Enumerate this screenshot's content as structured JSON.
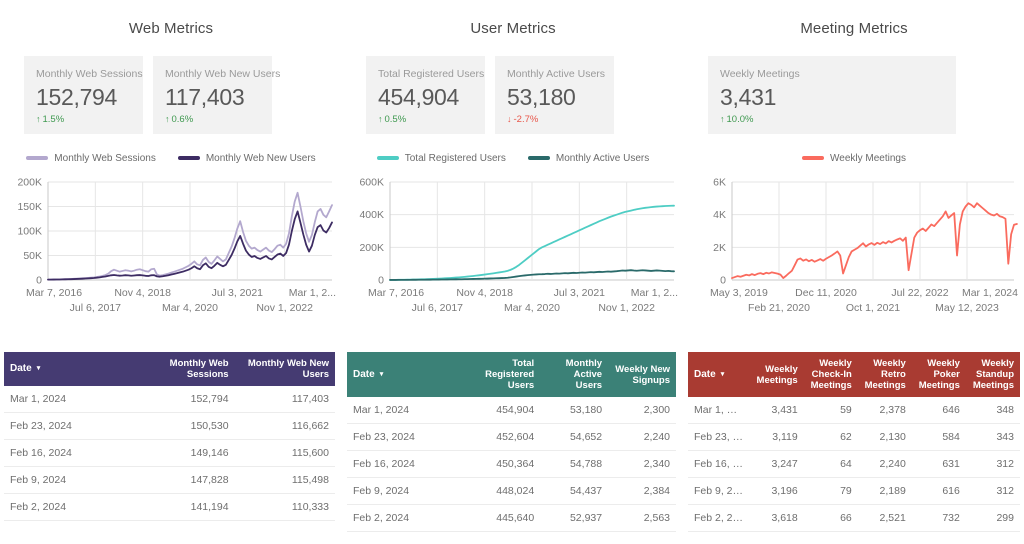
{
  "panels": [
    {
      "title": "Web Metrics",
      "tiles": [
        {
          "label": "Monthly Web Sessions",
          "value": "152,794",
          "delta": "1.5%",
          "direction": "up",
          "arrow": "↑"
        },
        {
          "label": "Monthly Web New Users",
          "value": "117,403",
          "delta": "0.6%",
          "direction": "up",
          "arrow": "↑"
        }
      ],
      "legend": [
        {
          "label": "Monthly Web Sessions",
          "color": "#b3a8ce"
        },
        {
          "label": "Monthly Web New Users",
          "color": "#3d2c63"
        }
      ]
    },
    {
      "title": "User Metrics",
      "tiles": [
        {
          "label": "Total Registered Users",
          "value": "454,904",
          "delta": "0.5%",
          "direction": "up",
          "arrow": "↑"
        },
        {
          "label": "Monthly Active Users",
          "value": "53,180",
          "delta": "-2.7%",
          "direction": "down",
          "arrow": "↓"
        }
      ],
      "legend": [
        {
          "label": "Total Registered Users",
          "color": "#4ecdc4"
        },
        {
          "label": "Monthly Active Users",
          "color": "#2a6a6a"
        }
      ]
    },
    {
      "title": "Meeting Metrics",
      "tiles": [
        {
          "label": "Weekly Meetings",
          "value": "3,431",
          "delta": "10.0%",
          "direction": "up",
          "arrow": "↑"
        }
      ],
      "legend": [
        {
          "label": "Weekly Meetings",
          "color": "#fa6b5e"
        }
      ]
    }
  ],
  "chart_data": [
    {
      "type": "line",
      "title": "Web Metrics",
      "xlabel": "",
      "ylabel": "",
      "ylim": [
        0,
        200000
      ],
      "yticks": [
        0,
        50000,
        100000,
        150000,
        200000
      ],
      "yticklabels": [
        "0",
        "50K",
        "100K",
        "150K",
        "200K"
      ],
      "grid": true,
      "legend_position": "top",
      "xticklabels": [
        "Mar 7, 2016",
        "Jul 6, 2017",
        "Nov 4, 2018",
        "Mar 4, 2020",
        "Jul 3, 2021",
        "Nov 1, 2022",
        "Mar 1, 2..."
      ],
      "x": [
        0,
        1,
        2,
        3,
        4,
        5,
        6,
        7,
        8,
        9,
        10,
        11,
        12,
        13,
        14,
        15,
        16,
        17,
        18,
        19,
        20,
        21,
        22,
        23,
        24,
        25,
        26,
        27,
        28,
        29,
        30,
        31,
        32,
        33,
        34,
        35,
        36,
        37,
        38,
        39,
        40,
        41,
        42,
        43,
        44,
        45,
        46,
        47,
        48,
        49,
        50,
        51,
        52,
        53,
        54,
        55,
        56,
        57,
        58,
        59,
        60,
        61,
        62,
        63,
        64,
        65,
        66,
        67,
        68,
        69,
        70,
        71,
        72,
        73,
        74,
        75,
        76,
        77,
        78,
        79,
        80,
        81,
        82,
        83,
        84,
        85,
        86,
        87,
        88,
        89,
        90,
        91,
        92,
        93,
        94,
        95,
        96,
        97,
        98,
        99
      ],
      "series": [
        {
          "name": "Monthly Web Sessions",
          "color": "#b3a8ce",
          "values": [
            900,
            1000,
            1100,
            1200,
            1300,
            1500,
            1700,
            1900,
            2100,
            2400,
            2700,
            3000,
            3400,
            3800,
            4200,
            4700,
            5200,
            6000,
            7000,
            8500,
            10000,
            13000,
            18000,
            21000,
            19000,
            17000,
            18500,
            20000,
            19000,
            17500,
            19000,
            21000,
            22000,
            20000,
            18000,
            17000,
            22000,
            23000,
            11000,
            9000,
            10000,
            11500,
            13000,
            15000,
            17000,
            19000,
            21000,
            23000,
            26000,
            29000,
            33000,
            38000,
            32000,
            30000,
            41000,
            46000,
            37000,
            33000,
            40000,
            48000,
            43000,
            38000,
            42000,
            55000,
            68000,
            85000,
            105000,
            120000,
            98000,
            80000,
            70000,
            64000,
            66000,
            61000,
            58000,
            62000,
            66000,
            60000,
            57000,
            63000,
            70000,
            72000,
            66000,
            74000,
            95000,
            130000,
            160000,
            178000,
            150000,
            120000,
            95000,
            78000,
            92000,
            118000,
            140000,
            145000,
            133000,
            128000,
            140000,
            152794
          ]
        },
        {
          "name": "Monthly Web New Users",
          "color": "#3d2c63",
          "values": [
            700,
            800,
            880,
            960,
            1040,
            1200,
            1360,
            1520,
            1680,
            1900,
            2150,
            2400,
            2700,
            3000,
            3300,
            3700,
            4100,
            4700,
            5400,
            6400,
            7200,
            8400,
            9600,
            10200,
            9400,
            8800,
            9200,
            9800,
            9400,
            8700,
            9200,
            9800,
            10100,
            9400,
            8600,
            8200,
            9600,
            9900,
            7400,
            6800,
            7600,
            8600,
            9800,
            11200,
            12600,
            14000,
            15600,
            17000,
            19000,
            21000,
            24000,
            28000,
            24000,
            22000,
            30000,
            34000,
            27000,
            24000,
            29000,
            35000,
            31000,
            28000,
            31000,
            41000,
            51000,
            64000,
            79000,
            90000,
            74000,
            60000,
            52000,
            47000,
            49000,
            45000,
            43000,
            46000,
            49000,
            44000,
            42000,
            47000,
            52000,
            54000,
            49000,
            55000,
            72000,
            100000,
            124000,
            140000,
            117000,
            93000,
            72000,
            58000,
            70000,
            92000,
            108000,
            112000,
            101000,
            97000,
            106000,
            117403
          ]
        }
      ]
    },
    {
      "type": "line",
      "title": "User Metrics",
      "xlabel": "",
      "ylabel": "",
      "ylim": [
        0,
        600000
      ],
      "yticks": [
        0,
        200000,
        400000,
        600000
      ],
      "yticklabels": [
        "0",
        "200K",
        "400K",
        "600K"
      ],
      "grid": true,
      "legend_position": "top",
      "xticklabels": [
        "Mar 7, 2016",
        "Jul 6, 2017",
        "Nov 4, 2018",
        "Mar 4, 2020",
        "Jul 3, 2021",
        "Nov 1, 2022",
        "Mar 1, 2..."
      ],
      "x": [
        0,
        1,
        2,
        3,
        4,
        5,
        6,
        7,
        8,
        9,
        10,
        11,
        12,
        13,
        14,
        15,
        16,
        17,
        18,
        19,
        20,
        21,
        22,
        23,
        24,
        25,
        26,
        27,
        28,
        29,
        30,
        31,
        32,
        33,
        34,
        35,
        36,
        37,
        38,
        39,
        40,
        41,
        42,
        43,
        44,
        45,
        46,
        47,
        48,
        49,
        50,
        51,
        52,
        53,
        54,
        55,
        56,
        57,
        58,
        59,
        60,
        61,
        62,
        63,
        64,
        65,
        66,
        67,
        68,
        69,
        70,
        71,
        72,
        73,
        74,
        75,
        76,
        77,
        78,
        79,
        80,
        81,
        82,
        83,
        84,
        85,
        86,
        87,
        88,
        89,
        90,
        91,
        92,
        93,
        94,
        95,
        96,
        97,
        98,
        99
      ],
      "series": [
        {
          "name": "Total Registered Users",
          "color": "#4ecdc4",
          "values": [
            500,
            700,
            900,
            1100,
            1400,
            1700,
            2000,
            2400,
            2800,
            3200,
            3700,
            4200,
            4800,
            5400,
            6100,
            6800,
            7600,
            8400,
            9300,
            10200,
            11200,
            12300,
            13500,
            14800,
            16200,
            17700,
            19300,
            21000,
            22800,
            24700,
            26700,
            28800,
            31000,
            33300,
            35700,
            38200,
            40800,
            43500,
            46300,
            49200,
            52000,
            56000,
            62000,
            70000,
            80000,
            92000,
            106000,
            120000,
            134000,
            148000,
            162000,
            176000,
            190000,
            200000,
            208000,
            216000,
            224000,
            232000,
            240000,
            248000,
            256000,
            264000,
            272000,
            280000,
            288000,
            296000,
            304000,
            312000,
            320000,
            328000,
            336000,
            344000,
            352000,
            360000,
            367000,
            374000,
            381000,
            388000,
            394000,
            400000,
            406000,
            412000,
            417000,
            421000,
            425000,
            429000,
            433000,
            436000,
            439000,
            442000,
            444000,
            446000,
            448000,
            449500,
            451000,
            452000,
            453000,
            453800,
            454400,
            454904
          ]
        },
        {
          "name": "Monthly Active Users",
          "color": "#2a6a6a",
          "values": [
            300,
            400,
            500,
            600,
            700,
            800,
            900,
            1000,
            1100,
            1200,
            1350,
            1500,
            1650,
            1800,
            2000,
            2200,
            2400,
            2600,
            2850,
            3100,
            3350,
            3600,
            3900,
            4200,
            4500,
            4800,
            5200,
            5600,
            6000,
            6400,
            6800,
            7300,
            7800,
            8300,
            8800,
            9400,
            10000,
            10600,
            11200,
            11900,
            12600,
            14000,
            16000,
            18500,
            21000,
            23500,
            26000,
            28000,
            30000,
            31500,
            33000,
            34000,
            35000,
            35500,
            36500,
            38000,
            37000,
            38500,
            40000,
            39000,
            40500,
            42000,
            41000,
            42500,
            44000,
            43000,
            44500,
            46000,
            45000,
            46500,
            48000,
            47000,
            48500,
            50000,
            49000,
            50500,
            52000,
            51000,
            52500,
            54000,
            56000,
            58000,
            57000,
            58500,
            60000,
            58000,
            56500,
            58000,
            59500,
            58500,
            57000,
            55500,
            57000,
            58500,
            57500,
            56000,
            54500,
            56000,
            54000,
            53180
          ]
        }
      ]
    },
    {
      "type": "line",
      "title": "Meeting Metrics",
      "xlabel": "",
      "ylabel": "",
      "ylim": [
        0,
        6000
      ],
      "yticks": [
        0,
        2000,
        4000,
        6000
      ],
      "yticklabels": [
        "0",
        "2K",
        "4K",
        "6K"
      ],
      "grid": true,
      "legend_position": "top",
      "xticklabels": [
        "May 3, 2019",
        "Feb 21, 2020",
        "Dec 11, 2020",
        "Oct 1, 2021",
        "Jul 22, 2022",
        "May 12, 2023",
        "Mar 1, 2024"
      ],
      "x": [
        0,
        1,
        2,
        3,
        4,
        5,
        6,
        7,
        8,
        9,
        10,
        11,
        12,
        13,
        14,
        15,
        16,
        17,
        18,
        19,
        20,
        21,
        22,
        23,
        24,
        25,
        26,
        27,
        28,
        29,
        30,
        31,
        32,
        33,
        34,
        35,
        36,
        37,
        38,
        39,
        40,
        41,
        42,
        43,
        44,
        45,
        46,
        47,
        48,
        49,
        50,
        51,
        52,
        53,
        54,
        55,
        56,
        57,
        58,
        59,
        60,
        61,
        62,
        63,
        64,
        65,
        66,
        67,
        68,
        69,
        70,
        71,
        72,
        73,
        74,
        75,
        76,
        77,
        78,
        79,
        80,
        81,
        82,
        83,
        84,
        85,
        86,
        87,
        88,
        89,
        90,
        91,
        92,
        93,
        94,
        95,
        96,
        97,
        98,
        99
      ],
      "series": [
        {
          "name": "Weekly Meetings",
          "color": "#fa6b5e",
          "values": [
            120,
            180,
            240,
            200,
            260,
            320,
            280,
            360,
            300,
            380,
            420,
            360,
            440,
            400,
            470,
            430,
            390,
            330,
            120,
            260,
            420,
            560,
            900,
            1250,
            1320,
            1180,
            1260,
            1150,
            1230,
            1120,
            1200,
            1280,
            1180,
            1300,
            1400,
            1500,
            1620,
            1750,
            1500,
            400,
            900,
            1400,
            1750,
            1850,
            1950,
            2100,
            2250,
            2050,
            2180,
            2260,
            2150,
            2280,
            2200,
            2320,
            2240,
            2380,
            2300,
            2400,
            2480,
            2550,
            2400,
            2600,
            600,
            1600,
            2600,
            2900,
            3050,
            3150,
            3000,
            3200,
            3400,
            3300,
            3500,
            3700,
            3900,
            4200,
            3800,
            3950,
            4100,
            1500,
            3400,
            4200,
            4500,
            4700,
            4600,
            4450,
            4700,
            4550,
            4400,
            4250,
            4100,
            4000,
            3950,
            4050,
            3900,
            3850,
            3750,
            1000,
            2800,
            3380,
            3431
          ]
        }
      ]
    }
  ],
  "tables": [
    {
      "accent": "#453b72",
      "sort_caret": "▾",
      "columns": [
        "Date",
        "Monthly Web Sessions",
        "Monthly Web New Users"
      ],
      "rows": [
        [
          "Mar 1, 2024",
          "152,794",
          "117,403"
        ],
        [
          "Feb 23, 2024",
          "150,530",
          "116,662"
        ],
        [
          "Feb 16, 2024",
          "149,146",
          "115,600"
        ],
        [
          "Feb 9, 2024",
          "147,828",
          "115,498"
        ],
        [
          "Feb 2, 2024",
          "141,194",
          "110,333"
        ]
      ]
    },
    {
      "accent": "#3b8177",
      "sort_caret": "▾",
      "columns": [
        "Date",
        "Total Registered Users",
        "Monthly Active Users",
        "Weekly New Signups"
      ],
      "rows": [
        [
          "Mar 1, 2024",
          "454,904",
          "53,180",
          "2,300"
        ],
        [
          "Feb 23, 2024",
          "452,604",
          "54,652",
          "2,240"
        ],
        [
          "Feb 16, 2024",
          "450,364",
          "54,788",
          "2,340"
        ],
        [
          "Feb 9, 2024",
          "448,024",
          "54,437",
          "2,384"
        ],
        [
          "Feb 2, 2024",
          "445,640",
          "52,937",
          "2,563"
        ]
      ]
    },
    {
      "accent": "#a93b32",
      "sort_caret": "▾",
      "columns": [
        "Date",
        "Weekly Meetings",
        "Weekly Check-In Meetings",
        "Weekly Retro Meetings",
        "Weekly Poker Meetings",
        "Weekly Standup Meetings"
      ],
      "rows": [
        [
          "Mar 1, …",
          "3,431",
          "59",
          "2,378",
          "646",
          "348"
        ],
        [
          "Feb 23, …",
          "3,119",
          "62",
          "2,130",
          "584",
          "343"
        ],
        [
          "Feb 16, …",
          "3,247",
          "64",
          "2,240",
          "631",
          "312"
        ],
        [
          "Feb 9, 2…",
          "3,196",
          "79",
          "2,189",
          "616",
          "312"
        ],
        [
          "Feb 2, 2…",
          "3,618",
          "66",
          "2,521",
          "732",
          "299"
        ]
      ]
    }
  ]
}
